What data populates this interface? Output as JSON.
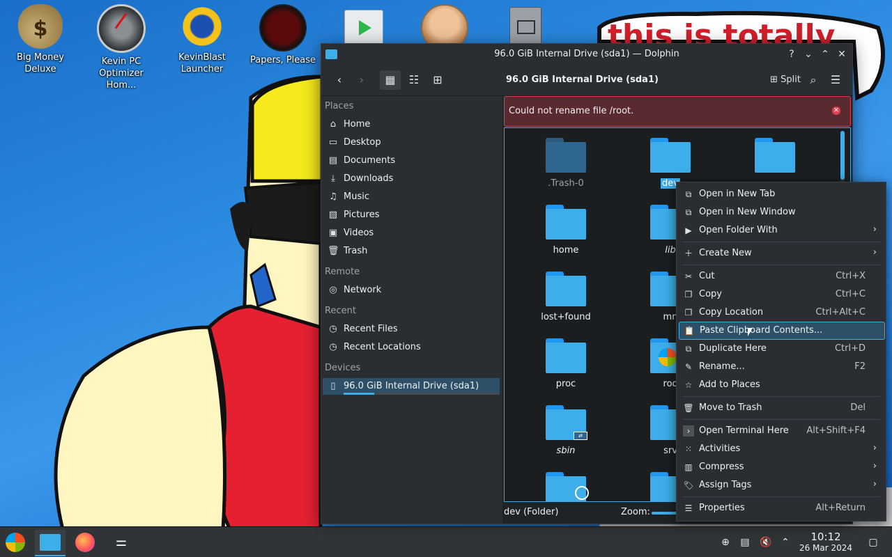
{
  "desktop": {
    "icons": [
      {
        "label": "Big Money\nDeluxe",
        "icon": "money-bag-icon"
      },
      {
        "label": "Kevin PC\nOptimizer Hom...",
        "icon": "speedometer-icon"
      },
      {
        "label": "KevinBlast\nLauncher",
        "icon": "sunburst-icon"
      },
      {
        "label": "Papers, Please",
        "icon": "papers-please-icon"
      },
      {
        "label": "",
        "icon": "media-play-icon"
      },
      {
        "label": "",
        "icon": "old-man-face-icon"
      },
      {
        "label": "",
        "icon": "document-window-icon"
      }
    ],
    "wallpaper_text": "this is totally"
  },
  "window": {
    "title": "96.0 GiB Internal Drive (sda1) — Dolphin",
    "controls": {
      "help": "?",
      "minimize": "⌄",
      "maximize": "⌃",
      "close": "✕"
    },
    "toolbar": {
      "location": "96.0 GiB Internal Drive (sda1)",
      "split_label": "Split"
    },
    "error": "Could not rename file /root.",
    "places": {
      "sections": {
        "places": "Places",
        "remote": "Remote",
        "recent": "Recent",
        "devices": "Devices"
      },
      "items": [
        {
          "label": "Home",
          "icon": "home-icon"
        },
        {
          "label": "Desktop",
          "icon": "desktop-icon"
        },
        {
          "label": "Documents",
          "icon": "documents-icon"
        },
        {
          "label": "Downloads",
          "icon": "downloads-icon"
        },
        {
          "label": "Music",
          "icon": "music-icon"
        },
        {
          "label": "Pictures",
          "icon": "pictures-icon"
        },
        {
          "label": "Videos",
          "icon": "videos-icon"
        },
        {
          "label": "Trash",
          "icon": "trash-icon"
        }
      ],
      "remote": [
        {
          "label": "Network",
          "icon": "network-icon"
        }
      ],
      "recent": [
        {
          "label": "Recent Files",
          "icon": "recent-files-icon"
        },
        {
          "label": "Recent Locations",
          "icon": "recent-locations-icon"
        }
      ],
      "devices": [
        {
          "label": "96.0 GiB Internal Drive (sda1)",
          "icon": "drive-icon",
          "usage": 0.2
        }
      ]
    },
    "files": [
      {
        "name": ".Trash-0",
        "style": "dim"
      },
      {
        "name": "dev",
        "style": "selected"
      },
      {
        "name": "",
        "style": "normal"
      },
      {
        "name": "home",
        "style": "normal"
      },
      {
        "name": "lib",
        "style": "italic"
      },
      {
        "name": "lost+found",
        "style": "normal"
      },
      {
        "name": "mn",
        "style": "normal"
      },
      {
        "name": "proc",
        "style": "normal"
      },
      {
        "name": "roo",
        "style": "normal"
      },
      {
        "name": "sbin",
        "style": "italic"
      },
      {
        "name": "srv",
        "style": "normal"
      }
    ],
    "status": {
      "text": "dev (Folder)",
      "zoom_label": "Zoom:"
    }
  },
  "context_menu": {
    "items": [
      {
        "label": "Open in New Tab",
        "shortcut": "",
        "submenu": false,
        "icon": "new-tab-icon"
      },
      {
        "label": "Open in New Window",
        "shortcut": "",
        "submenu": false,
        "icon": "new-window-icon"
      },
      {
        "label": "Open Folder With",
        "shortcut": "",
        "submenu": true,
        "icon": "open-with-icon"
      },
      {
        "label": "Create New",
        "shortcut": "",
        "submenu": true,
        "icon": "plus-icon"
      },
      {
        "label": "Cut",
        "shortcut": "Ctrl+X",
        "submenu": false,
        "icon": "scissors-icon"
      },
      {
        "label": "Copy",
        "shortcut": "Ctrl+C",
        "submenu": false,
        "icon": "copy-icon"
      },
      {
        "label": "Copy Location",
        "shortcut": "Ctrl+Alt+C",
        "submenu": false,
        "icon": "copy-location-icon"
      },
      {
        "label": "Paste Clipboard Contents...",
        "shortcut": "",
        "submenu": false,
        "icon": "paste-icon"
      },
      {
        "label": "Duplicate Here",
        "shortcut": "Ctrl+D",
        "submenu": false,
        "icon": "duplicate-icon"
      },
      {
        "label": "Rename...",
        "shortcut": "F2",
        "submenu": false,
        "icon": "rename-icon"
      },
      {
        "label": "Add to Places",
        "shortcut": "",
        "submenu": false,
        "icon": "bookmark-icon"
      },
      {
        "label": "Move to Trash",
        "shortcut": "Del",
        "submenu": false,
        "icon": "trash-icon"
      },
      {
        "label": "Open Terminal Here",
        "shortcut": "Alt+Shift+F4",
        "submenu": false,
        "icon": "terminal-icon"
      },
      {
        "label": "Activities",
        "shortcut": "",
        "submenu": true,
        "icon": "activities-icon"
      },
      {
        "label": "Compress",
        "shortcut": "",
        "submenu": true,
        "icon": "compress-icon"
      },
      {
        "label": "Assign Tags",
        "shortcut": "",
        "submenu": true,
        "icon": "tag-icon"
      },
      {
        "label": "Properties",
        "shortcut": "Alt+Return",
        "submenu": false,
        "icon": "properties-icon"
      }
    ],
    "highlighted": "Paste Clipboard Contents..."
  },
  "taskbar": {
    "clock": {
      "time": "10:12",
      "date": "26 Mar 2024"
    }
  },
  "colors": {
    "accent": "#3daee9",
    "error": "#da4453",
    "window_bg": "#202326"
  }
}
